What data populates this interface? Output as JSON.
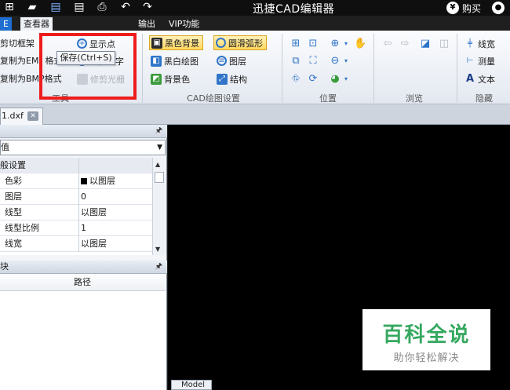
{
  "titlebar": {
    "app_title": "迅捷CAD编辑器",
    "buy_label": "购买",
    "coin_symbol": "¥"
  },
  "menu": {
    "tabs": [
      "E",
      "查看器",
      "输出",
      "VIP功能"
    ]
  },
  "tooltip": "保存(Ctrl+S)",
  "ribbon": {
    "tools": {
      "label": "工具",
      "items": [
        "剪切框架",
        "复制为EM",
        "格式",
        "复制为BMP格式",
        "显示点",
        "查找文字",
        "修剪光栅"
      ]
    },
    "cad_settings": {
      "label": "CAD绘图设置",
      "items": [
        "黑色背景",
        "圆滑弧形",
        "黑白绘图",
        "图层",
        "背景色",
        "结构"
      ]
    },
    "position": {
      "label": "位置"
    },
    "browse": {
      "label": "浏览"
    },
    "hide": {
      "label": "隐藏",
      "items": [
        "线宽",
        "测量",
        "文本"
      ]
    }
  },
  "document_tab": "1.dxf",
  "properties_panel": {
    "select_value": "值",
    "category": "般设置",
    "rows": [
      {
        "key": "色彩",
        "value": "以图层"
      },
      {
        "key": "图层",
        "value": "0"
      },
      {
        "key": "线型",
        "value": "以图层"
      },
      {
        "key": "线型比例",
        "value": "1"
      },
      {
        "key": "线宽",
        "value": "以图层"
      }
    ]
  },
  "blocks_panel": {
    "title": "块",
    "column": "路径"
  },
  "model_tab": "Model",
  "watermark": {
    "main": "百科全说",
    "sub": "助你轻松解决"
  }
}
